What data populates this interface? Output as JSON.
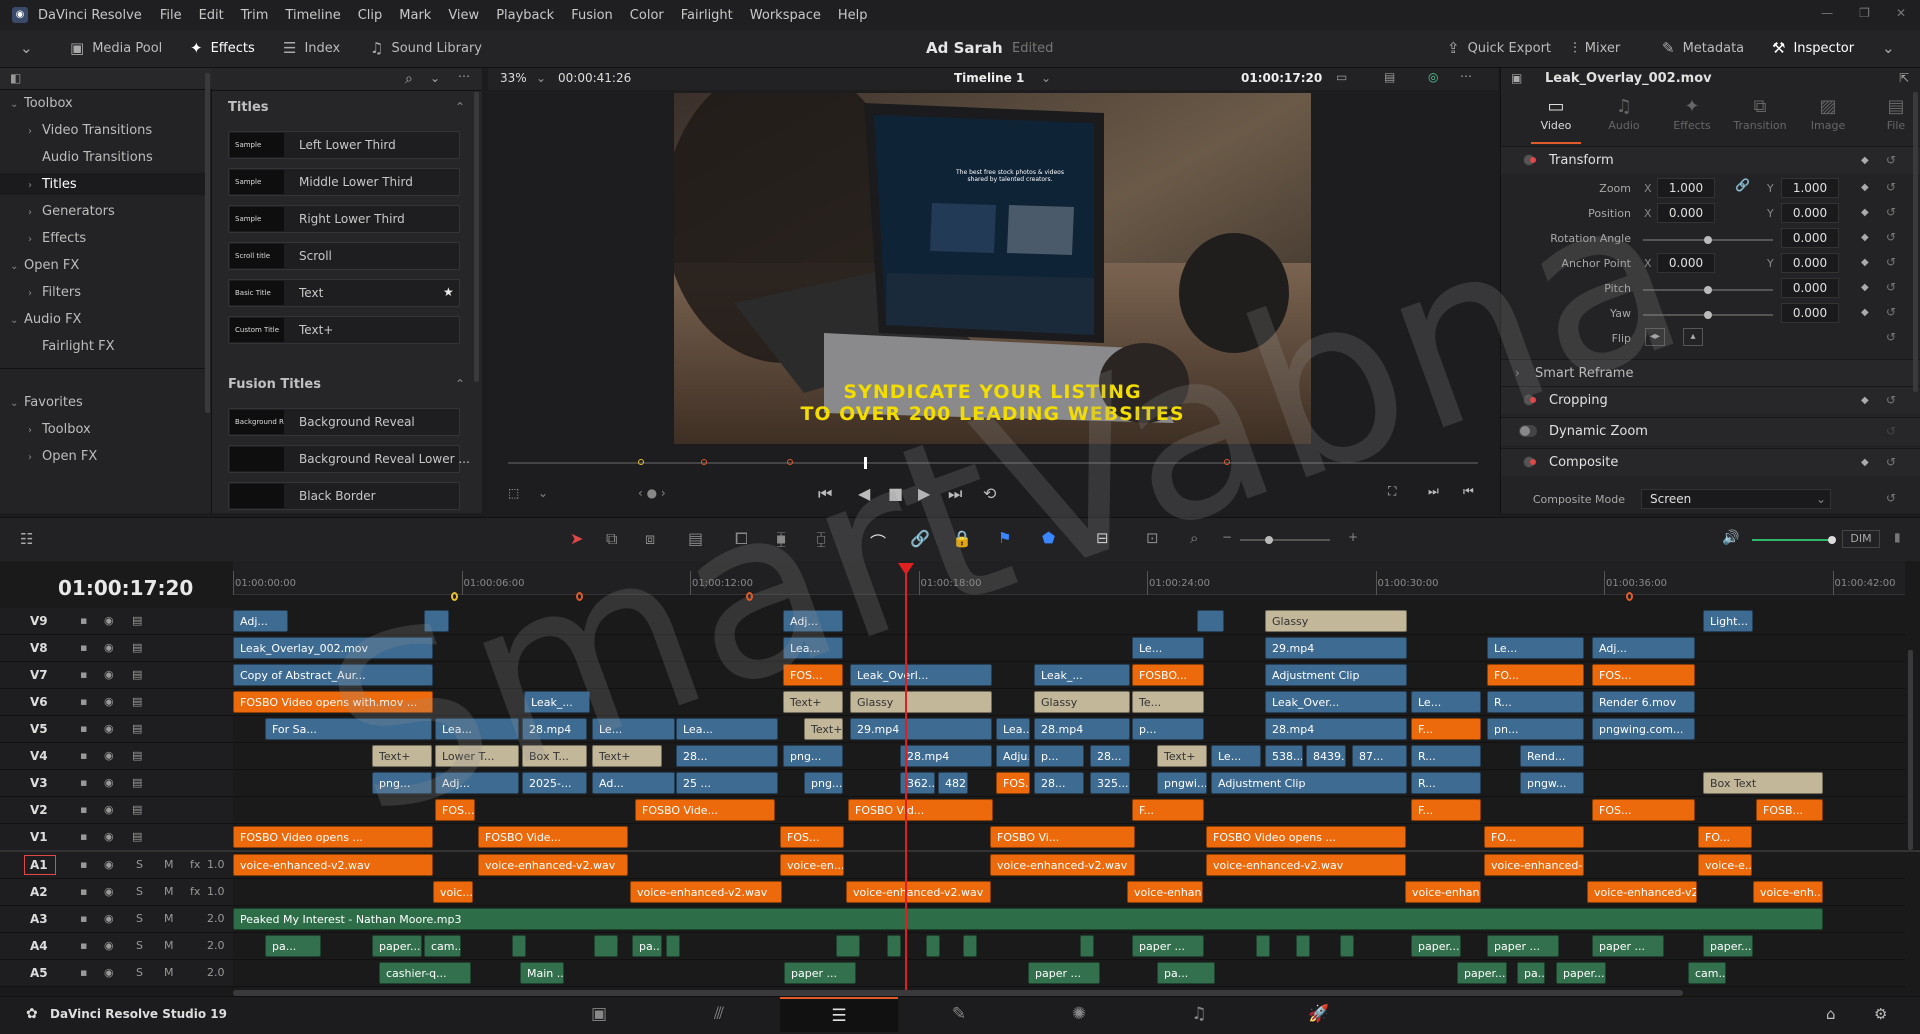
{
  "menubar": {
    "app": "DaVinci Resolve",
    "items": [
      "File",
      "Edit",
      "Trim",
      "Timeline",
      "Clip",
      "Mark",
      "View",
      "Playback",
      "Fusion",
      "Color",
      "Fairlight",
      "Workspace",
      "Help"
    ]
  },
  "toolbar": {
    "media_pool": "Media Pool",
    "effects": "Effects",
    "index": "Index",
    "sound_library": "Sound Library",
    "project_name": "Ad Sarah",
    "project_status": "Edited",
    "quick_export": "Quick Export",
    "mixer": "Mixer",
    "metadata": "Metadata",
    "inspector": "Inspector"
  },
  "left_panel": {
    "tree": [
      {
        "label": "Toolbox",
        "chev": "⌄",
        "indent": 0
      },
      {
        "label": "Video Transitions",
        "chev": "›",
        "indent": 1
      },
      {
        "label": "Audio Transitions",
        "chev": "",
        "indent": 1
      },
      {
        "label": "Titles",
        "chev": "›",
        "indent": 1,
        "selected": true
      },
      {
        "label": "Generators",
        "chev": "›",
        "indent": 1
      },
      {
        "label": "Effects",
        "chev": "›",
        "indent": 1
      },
      {
        "label": "Open FX",
        "chev": "⌄",
        "indent": 0
      },
      {
        "label": "Filters",
        "chev": "›",
        "indent": 1
      },
      {
        "label": "Audio FX",
        "chev": "⌄",
        "indent": 0
      },
      {
        "label": "Fairlight FX",
        "chev": "",
        "indent": 1
      }
    ],
    "favorites": [
      {
        "label": "Favorites",
        "chev": "⌄",
        "indent": 0
      },
      {
        "label": "Toolbox",
        "chev": "›",
        "indent": 1
      },
      {
        "label": "Open FX",
        "chev": "›",
        "indent": 1
      }
    ]
  },
  "effects_list": {
    "titles_header": "Titles",
    "titles": [
      {
        "name": "Left Lower Third",
        "thumb": "Sample"
      },
      {
        "name": "Middle Lower Third",
        "thumb": "Sample"
      },
      {
        "name": "Right Lower Third",
        "thumb": "Sample"
      },
      {
        "name": "Scroll",
        "thumb": "Scroll title"
      },
      {
        "name": "Text",
        "thumb": "Basic Title",
        "star": true
      },
      {
        "name": "Text+",
        "thumb": "Custom Title"
      }
    ],
    "fusion_header": "Fusion Titles",
    "fusion": [
      {
        "name": "Background Reveal",
        "thumb": "Background Reveal"
      },
      {
        "name": "Background Reveal Lower ...",
        "thumb": ""
      },
      {
        "name": "Black Border",
        "thumb": ""
      }
    ]
  },
  "viewer": {
    "zoom": "33%",
    "source_tc": "00:00:41:26",
    "timeline_name": "Timeline 1",
    "record_tc": "01:00:17:20",
    "headline": [
      "SYNDICATE YOUR LISTING",
      "TO OVER 200 LEADING WEBSITES"
    ],
    "laptop_text": "The best free stock photos & videos shared by talented creators."
  },
  "inspector": {
    "clip_name": "Leak_Overlay_002.mov",
    "tabs": [
      "Video",
      "Audio",
      "Effects",
      "Transition",
      "Image",
      "File"
    ],
    "transform": {
      "title": "Transform",
      "zoom_label": "Zoom",
      "zoom_x": "1.000",
      "zoom_y": "1.000",
      "position_label": "Position",
      "pos_x": "0.000",
      "pos_y": "0.000",
      "rotation_label": "Rotation Angle",
      "rotation": "0.000",
      "anchor_label": "Anchor Point",
      "anchor_x": "0.000",
      "anchor_y": "0.000",
      "pitch_label": "Pitch",
      "pitch": "0.000",
      "yaw_label": "Yaw",
      "yaw": "0.000",
      "flip_label": "Flip"
    },
    "smart_reframe": "Smart Reframe",
    "cropping": "Cropping",
    "dynamic_zoom": "Dynamic Zoom",
    "composite": "Composite",
    "composite_mode_label": "Composite Mode",
    "composite_mode": "Screen"
  },
  "timeline": {
    "timecode": "01:00:17:20",
    "ruler": [
      "01:00:00:00",
      "01:00:06:00",
      "01:00:12:00",
      "01:00:18:00",
      "01:00:24:00",
      "01:00:30:00",
      "01:00:36:00",
      "01:00:42:00"
    ],
    "dim": "DIM",
    "video_tracks": [
      "V9",
      "V8",
      "V7",
      "V6",
      "V5",
      "V4",
      "V3",
      "V2",
      "V1"
    ],
    "audio_tracks": [
      {
        "name": "A1",
        "level": "1.0"
      },
      {
        "name": "A2",
        "level": "1.0"
      },
      {
        "name": "A3",
        "level": "2.0"
      },
      {
        "name": "A4",
        "level": "2.0"
      },
      {
        "name": "A5",
        "level": "2.0"
      }
    ],
    "clips": [
      [
        "V9",
        "Adj...",
        "blue",
        233,
        55
      ],
      [
        "V9",
        "",
        "blue",
        424,
        25
      ],
      [
        "V9",
        "Adj...",
        "blue",
        783,
        60
      ],
      [
        "V9",
        "",
        "blue",
        1197,
        27
      ],
      [
        "V9",
        "Glassy",
        "beige",
        1265,
        142
      ],
      [
        "V9",
        "Light...",
        "blue",
        1703,
        50
      ],
      [
        "V8",
        "Leak_Overlay_002.mov",
        "blue",
        233,
        200
      ],
      [
        "V8",
        "Lea...",
        "blue",
        783,
        60
      ],
      [
        "V8",
        "Le...",
        "blue",
        1132,
        72
      ],
      [
        "V8",
        "29.mp4",
        "blue",
        1265,
        142
      ],
      [
        "V8",
        "Le...",
        "blue",
        1487,
        97
      ],
      [
        "V8",
        "Adj...",
        "blue",
        1592,
        103
      ],
      [
        "V7",
        "Copy of Abstract_Aur...",
        "blue",
        233,
        200
      ],
      [
        "V7",
        "FOS...",
        "orange",
        783,
        60
      ],
      [
        "V7",
        "Leak_Overl...",
        "blue",
        850,
        142
      ],
      [
        "V7",
        "Leak_...",
        "blue",
        1034,
        96
      ],
      [
        "V7",
        "FOSBO...",
        "orange",
        1132,
        72
      ],
      [
        "V7",
        "Adjustment Clip",
        "blue",
        1265,
        142
      ],
      [
        "V7",
        "FO...",
        "orange",
        1487,
        97
      ],
      [
        "V7",
        "FOS...",
        "orange",
        1592,
        103
      ],
      [
        "V6",
        "FOSBO Video opens with.mov ...",
        "orange",
        233,
        200
      ],
      [
        "V6",
        "Leak_...",
        "blue",
        524,
        66
      ],
      [
        "V6",
        "Text+",
        "beige",
        783,
        60
      ],
      [
        "V6",
        "Glassy",
        "beige",
        850,
        142
      ],
      [
        "V6",
        "Glassy",
        "beige",
        1034,
        96
      ],
      [
        "V6",
        "Te...",
        "beige",
        1132,
        72
      ],
      [
        "V6",
        "Leak_Over...",
        "blue",
        1265,
        142
      ],
      [
        "V6",
        "Le...",
        "blue",
        1411,
        70
      ],
      [
        "V6",
        "R...",
        "blue",
        1487,
        97
      ],
      [
        "V6",
        "Render 6.mov",
        "blue",
        1592,
        103
      ],
      [
        "V5",
        "For Sa...",
        "blue",
        265,
        167
      ],
      [
        "V5",
        "Lea...",
        "blue",
        435,
        84
      ],
      [
        "V5",
        "28.mp4",
        "blue",
        522,
        65
      ],
      [
        "V5",
        "Le...",
        "blue",
        592,
        83
      ],
      [
        "V5",
        "Lea...",
        "blue",
        676,
        102
      ],
      [
        "V5",
        "Text+",
        "beige",
        804,
        39
      ],
      [
        "V5",
        "29.mp4",
        "blue",
        850,
        142
      ],
      [
        "V5",
        "Lea...",
        "blue",
        996,
        34
      ],
      [
        "V5",
        "28.mp4",
        "blue",
        1034,
        96
      ],
      [
        "V5",
        "p...",
        "blue",
        1132,
        72
      ],
      [
        "V5",
        "28.mp4",
        "blue",
        1265,
        142
      ],
      [
        "V5",
        "F...",
        "orange",
        1411,
        70
      ],
      [
        "V5",
        "pn...",
        "blue",
        1487,
        97
      ],
      [
        "V5",
        "pngwing.com...",
        "blue",
        1592,
        103
      ],
      [
        "V4",
        "Text+",
        "beige",
        372,
        60
      ],
      [
        "V4",
        "Lower T...",
        "beige",
        435,
        84
      ],
      [
        "V4",
        "Box T...",
        "beige",
        522,
        65
      ],
      [
        "V4",
        "Text+",
        "beige",
        592,
        70
      ],
      [
        "V4",
        "28...",
        "blue",
        676,
        102
      ],
      [
        "V4",
        "png...",
        "blue",
        783,
        60
      ],
      [
        "V4",
        "28.mp4",
        "blue",
        900,
        92
      ],
      [
        "V4",
        "Adju...",
        "blue",
        996,
        34
      ],
      [
        "V4",
        "p...",
        "blue",
        1034,
        50
      ],
      [
        "V4",
        "28...",
        "blue",
        1090,
        40
      ],
      [
        "V4",
        "Text+",
        "beige",
        1157,
        50
      ],
      [
        "V4",
        "Le...",
        "blue",
        1211,
        50
      ],
      [
        "V4",
        "538...",
        "blue",
        1265,
        38
      ],
      [
        "V4",
        "8439...",
        "blue",
        1306,
        40
      ],
      [
        "V4",
        "87...",
        "blue",
        1352,
        55
      ],
      [
        "V4",
        "R...",
        "blue",
        1411,
        70
      ],
      [
        "V4",
        "Rend...",
        "blue",
        1520,
        64
      ],
      [
        "V3",
        "png...",
        "blue",
        372,
        60
      ],
      [
        "V3",
        "Adj...",
        "blue",
        435,
        84
      ],
      [
        "V3",
        "2025-...",
        "blue",
        522,
        65
      ],
      [
        "V3",
        "Ad...",
        "blue",
        592,
        83
      ],
      [
        "V3",
        "25 ...",
        "blue",
        676,
        102
      ],
      [
        "V3",
        "png...",
        "blue",
        804,
        39
      ],
      [
        "V3",
        "362...",
        "blue",
        900,
        35
      ],
      [
        "V3",
        "482...",
        "blue",
        938,
        30
      ],
      [
        "V3",
        "FOS...",
        "orange",
        996,
        34
      ],
      [
        "V3",
        "28...",
        "blue",
        1034,
        50
      ],
      [
        "V3",
        "325...",
        "blue",
        1090,
        40
      ],
      [
        "V3",
        "pngwi...",
        "blue",
        1157,
        50
      ],
      [
        "V3",
        "Adjustment Clip",
        "blue",
        1211,
        196
      ],
      [
        "V3",
        "R...",
        "blue",
        1411,
        70
      ],
      [
        "V3",
        "pngw...",
        "blue",
        1520,
        64
      ],
      [
        "V3",
        "Box Text",
        "beige",
        1703,
        120
      ],
      [
        "V2",
        "FOS...",
        "orange",
        435,
        40
      ],
      [
        "V2",
        "FOSBO Vide...",
        "orange",
        635,
        140
      ],
      [
        "V2",
        "FOSBO Vid...",
        "orange",
        848,
        145
      ],
      [
        "V2",
        "F...",
        "orange",
        1132,
        72
      ],
      [
        "V2",
        "F...",
        "orange",
        1411,
        70
      ],
      [
        "V2",
        "FOS...",
        "orange",
        1592,
        103
      ],
      [
        "V2",
        "FOSB...",
        "orange",
        1756,
        67
      ],
      [
        "V1",
        "FOSBO Video opens ...",
        "orange",
        233,
        200
      ],
      [
        "V1",
        "FOSBO Vide...",
        "orange",
        478,
        150
      ],
      [
        "V1",
        "FOS...",
        "orange",
        780,
        64
      ],
      [
        "V1",
        "FOSBO Vi...",
        "orange",
        990,
        145
      ],
      [
        "V1",
        "FOSBO Video opens ...",
        "orange",
        1206,
        200
      ],
      [
        "V1",
        "FO...",
        "orange",
        1484,
        100
      ],
      [
        "V1",
        "FO...",
        "orange",
        1698,
        54
      ],
      [
        "A1",
        "voice-enhanced-v2.wav",
        "orange",
        233,
        200
      ],
      [
        "A1",
        "voice-enhanced-v2.wav",
        "orange",
        478,
        150
      ],
      [
        "A1",
        "voice-en...",
        "orange",
        780,
        64
      ],
      [
        "A1",
        "voice-enhanced-v2.wav",
        "orange",
        990,
        145
      ],
      [
        "A1",
        "voice-enhanced-v2.wav",
        "orange",
        1206,
        200
      ],
      [
        "A1",
        "voice-enhanced-...",
        "orange",
        1484,
        100
      ],
      [
        "A1",
        "voice-e...",
        "orange",
        1698,
        54
      ],
      [
        "A2",
        "voic...",
        "orange",
        433,
        40
      ],
      [
        "A2",
        "voice-enhanced-v2.wav",
        "orange",
        630,
        152
      ],
      [
        "A2",
        "voice-enhanced-v2.wav",
        "orange",
        846,
        145
      ],
      [
        "A2",
        "voice-enhan...",
        "orange",
        1127,
        76
      ],
      [
        "A2",
        "voice-enhan...",
        "orange",
        1405,
        76
      ],
      [
        "A2",
        "voice-enhanced-v2....",
        "orange",
        1587,
        110
      ],
      [
        "A2",
        "voice-enh...",
        "orange",
        1753,
        70
      ],
      [
        "A3",
        "Peaked My Interest - Nathan Moore.mp3",
        "green",
        233,
        1590
      ],
      [
        "A4",
        "pa...",
        "gcube",
        265,
        56
      ],
      [
        "A4",
        "paper...",
        "gcube",
        372,
        50
      ],
      [
        "A4",
        "cam...",
        "gcube",
        424,
        37
      ],
      [
        "A4",
        "",
        "gcube",
        512,
        14
      ],
      [
        "A4",
        "",
        "gcube",
        594,
        24
      ],
      [
        "A4",
        "pa...",
        "gcube",
        632,
        30
      ],
      [
        "A4",
        "",
        "gcube",
        666,
        14
      ],
      [
        "A4",
        "",
        "gcube",
        836,
        24
      ],
      [
        "A4",
        "",
        "gcube",
        887,
        14
      ],
      [
        "A4",
        "",
        "gcube",
        926,
        14
      ],
      [
        "A4",
        "",
        "gcube",
        963,
        14
      ],
      [
        "A4",
        "",
        "gcube",
        1080,
        14
      ],
      [
        "A4",
        "paper ...",
        "gcube",
        1132,
        72
      ],
      [
        "A4",
        "",
        "gcube",
        1256,
        14
      ],
      [
        "A4",
        "",
        "gcube",
        1296,
        14
      ],
      [
        "A4",
        "",
        "gcube",
        1340,
        14
      ],
      [
        "A4",
        "paper...",
        "gcube",
        1411,
        50
      ],
      [
        "A4",
        "paper ...",
        "gcube",
        1487,
        72
      ],
      [
        "A4",
        "paper ...",
        "gcube",
        1592,
        72
      ],
      [
        "A4",
        "paper...",
        "gcube",
        1703,
        50
      ],
      [
        "A5",
        "cashier-q...",
        "gcube",
        379,
        92
      ],
      [
        "A5",
        "Main ...",
        "gcube",
        520,
        44
      ],
      [
        "A5",
        "paper ...",
        "gcube",
        784,
        72
      ],
      [
        "A5",
        "paper ...",
        "gcube",
        1028,
        72
      ],
      [
        "A5",
        "pa...",
        "gcube",
        1157,
        58
      ],
      [
        "A5",
        "paper...",
        "gcube",
        1457,
        50
      ],
      [
        "A5",
        "pa...",
        "gcube",
        1517,
        28
      ],
      [
        "A5",
        "paper...",
        "gcube",
        1556,
        50
      ],
      [
        "A5",
        "cam...",
        "gcube",
        1688,
        38
      ]
    ]
  },
  "statusbar": {
    "app": "DaVinci Resolve Studio 19"
  },
  "watermark": "SmartVabna"
}
